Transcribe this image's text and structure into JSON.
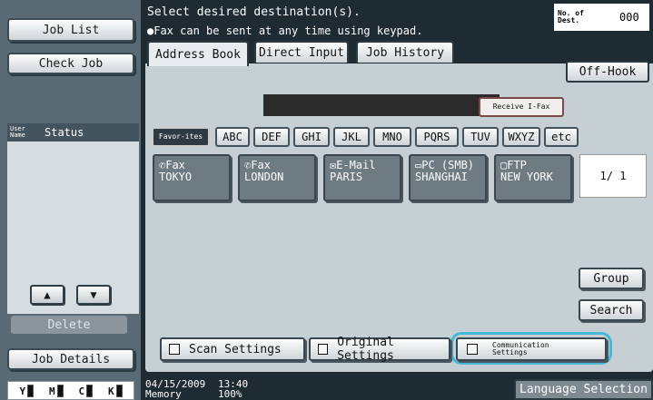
{
  "left_panel": {
    "job_list": "Job List",
    "check_job": "Check Job",
    "user_name_header": "User Name",
    "status_header": "Status",
    "delete": "Delete",
    "job_details": "Job Details",
    "toner": [
      "Y",
      "M",
      "C",
      "K"
    ]
  },
  "header": {
    "instruction": "Select desired destination(s).",
    "keypad_note": "Fax can be sent at any time using keypad.",
    "dest_count_label": "No. of Dest.",
    "dest_count_value": "000"
  },
  "tabs": [
    "Address Book",
    "Direct Input",
    "Job History"
  ],
  "off_hook": "Off-Hook",
  "receive_ifax": "Receive I-Fax",
  "index_tabs": [
    "Favor-ites",
    "ABC",
    "DEF",
    "GHI",
    "JKL",
    "MNO",
    "PQRS",
    "TUV",
    "WXYZ",
    "etc"
  ],
  "destinations": [
    {
      "type": "Fax",
      "name": "TOKYO",
      "icon": "fax-icon"
    },
    {
      "type": "Fax",
      "name": "LONDON",
      "icon": "fax-icon"
    },
    {
      "type": "E-Mail",
      "name": "PARIS",
      "icon": "email-icon"
    },
    {
      "type": "PC (SMB)",
      "name": "SHANGHAI",
      "icon": "pc-icon"
    },
    {
      "type": "FTP",
      "name": "NEW YORK",
      "icon": "ftp-icon"
    }
  ],
  "page_indicator": "1/ 1",
  "side_buttons": {
    "group": "Group",
    "search": "Search"
  },
  "bottom_buttons": {
    "scan_settings": "Scan Settings",
    "original_settings": "Original Settings",
    "communication_settings": "Communication Settings"
  },
  "footer": {
    "date": "04/15/2009",
    "time": "13:40",
    "memory_label": "Memory",
    "memory_value": "100%",
    "language": "Language Selection"
  },
  "colors": {
    "highlight": "#45b9d6",
    "background": "#1f2b33"
  }
}
